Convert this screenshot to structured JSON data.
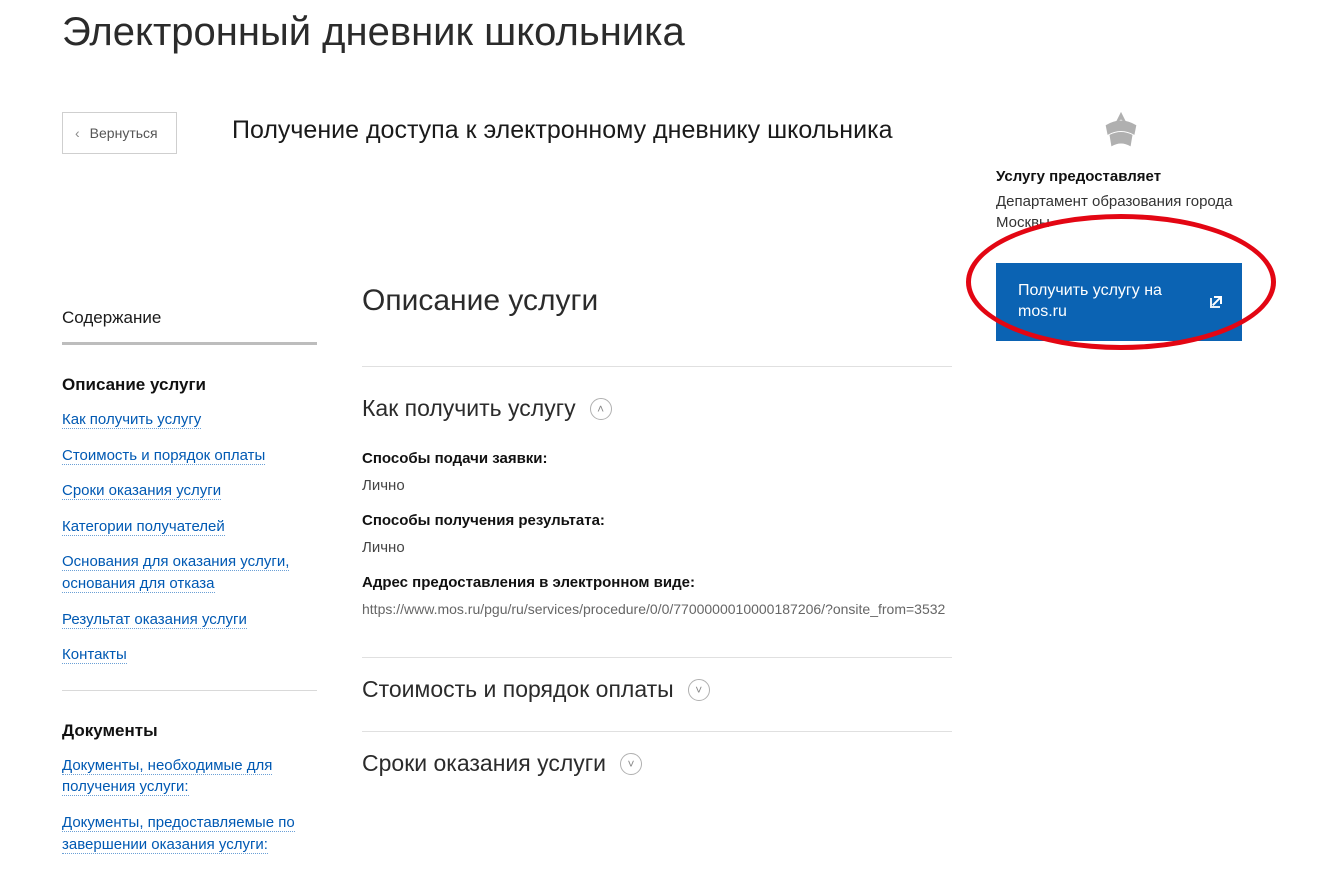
{
  "page_title": "Электронный дневник школьника",
  "back_label": "Вернуться",
  "subtitle": "Получение доступа к электронному дневнику школьника",
  "sidebar": {
    "toc_heading": "Содержание",
    "group1_heading": "Описание услуги",
    "links1": [
      "Как получить услугу",
      "Стоимость и порядок оплаты",
      "Сроки оказания услуги",
      "Категории получателей",
      "Основания для оказания услуги, основания для отказа",
      "Результат оказания услуги",
      "Контакты"
    ],
    "group2_heading": "Документы",
    "links2": [
      "Документы, необходимые для получения услуги:",
      "Документы, предоставляемые по завершении оказания услуги:"
    ]
  },
  "right": {
    "provided_by_label": "Услугу предоставляет",
    "provider_name": "Департамент образования города Москвы",
    "button_label": "Получить услугу на mos.ru"
  },
  "content": {
    "section_title": "Описание услуги",
    "how_to_heading": "Как получить услугу",
    "submit_label": "Способы подачи заявки:",
    "submit_value": "Лично",
    "result_label": "Способы получения результата:",
    "result_value": "Лично",
    "address_label": "Адрес предоставления в электронном виде:",
    "address_value": "https://www.mos.ru/pgu/ru/services/procedure/0/0/7700000010000187206/?onsite_from=3532",
    "cost_heading": "Стоимость и порядок оплаты",
    "timing_heading": "Сроки оказания услуги"
  }
}
